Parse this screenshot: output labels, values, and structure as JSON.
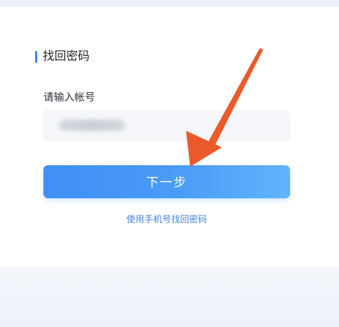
{
  "form": {
    "title": "找回密码",
    "account_label": "请输入帐号",
    "account_value_hidden": true,
    "next_button": "下一步",
    "phone_link": "使用手机号找回密码"
  },
  "colors": {
    "accent": "#2f86f6",
    "button_start": "#3f8ff5",
    "button_end": "#5fb4fb",
    "link": "#3b82d6",
    "annotation_arrow": "#ea5a2a"
  },
  "icons": {
    "annotation": "arrow-pointing-to-next-button"
  }
}
